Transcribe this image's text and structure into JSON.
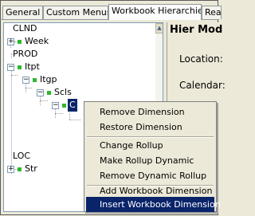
{
  "tabs": [
    {
      "label": "General"
    },
    {
      "label": "Custom Menus"
    },
    {
      "label": "Workbook Hierarchies"
    },
    {
      "label": "Rea"
    }
  ],
  "tree": {
    "nodes": [
      {
        "label": "CLND"
      },
      {
        "label": "Week"
      },
      {
        "label": "PROD"
      },
      {
        "label": "Itpt"
      },
      {
        "label": "Itgp"
      },
      {
        "label": "Scls"
      },
      {
        "label": "C"
      },
      {
        "label": "LOC"
      },
      {
        "label": "Str"
      }
    ]
  },
  "right_panel": {
    "title": "Hier Mod",
    "location_label": "Location:",
    "calendar_label": "Calendar:"
  },
  "context_menu": {
    "items": [
      {
        "label": "Remove Dimension"
      },
      {
        "label": "Restore Dimension"
      },
      {
        "label": "Change Rollup"
      },
      {
        "label": "Make Rollup Dynamic"
      },
      {
        "label": "Remove Dynamic Rollup"
      },
      {
        "label": "Add Workbook Dimension"
      },
      {
        "label": "Insert Workbook Dimension"
      }
    ],
    "highlighted_index": 6
  },
  "colors": {
    "node_marker": "#2fb92f",
    "selection": "#0a246a",
    "window_bg": "#ece9d8"
  },
  "icons": {
    "expand": "plus-box",
    "collapse": "minus-box",
    "node": "green-square"
  }
}
